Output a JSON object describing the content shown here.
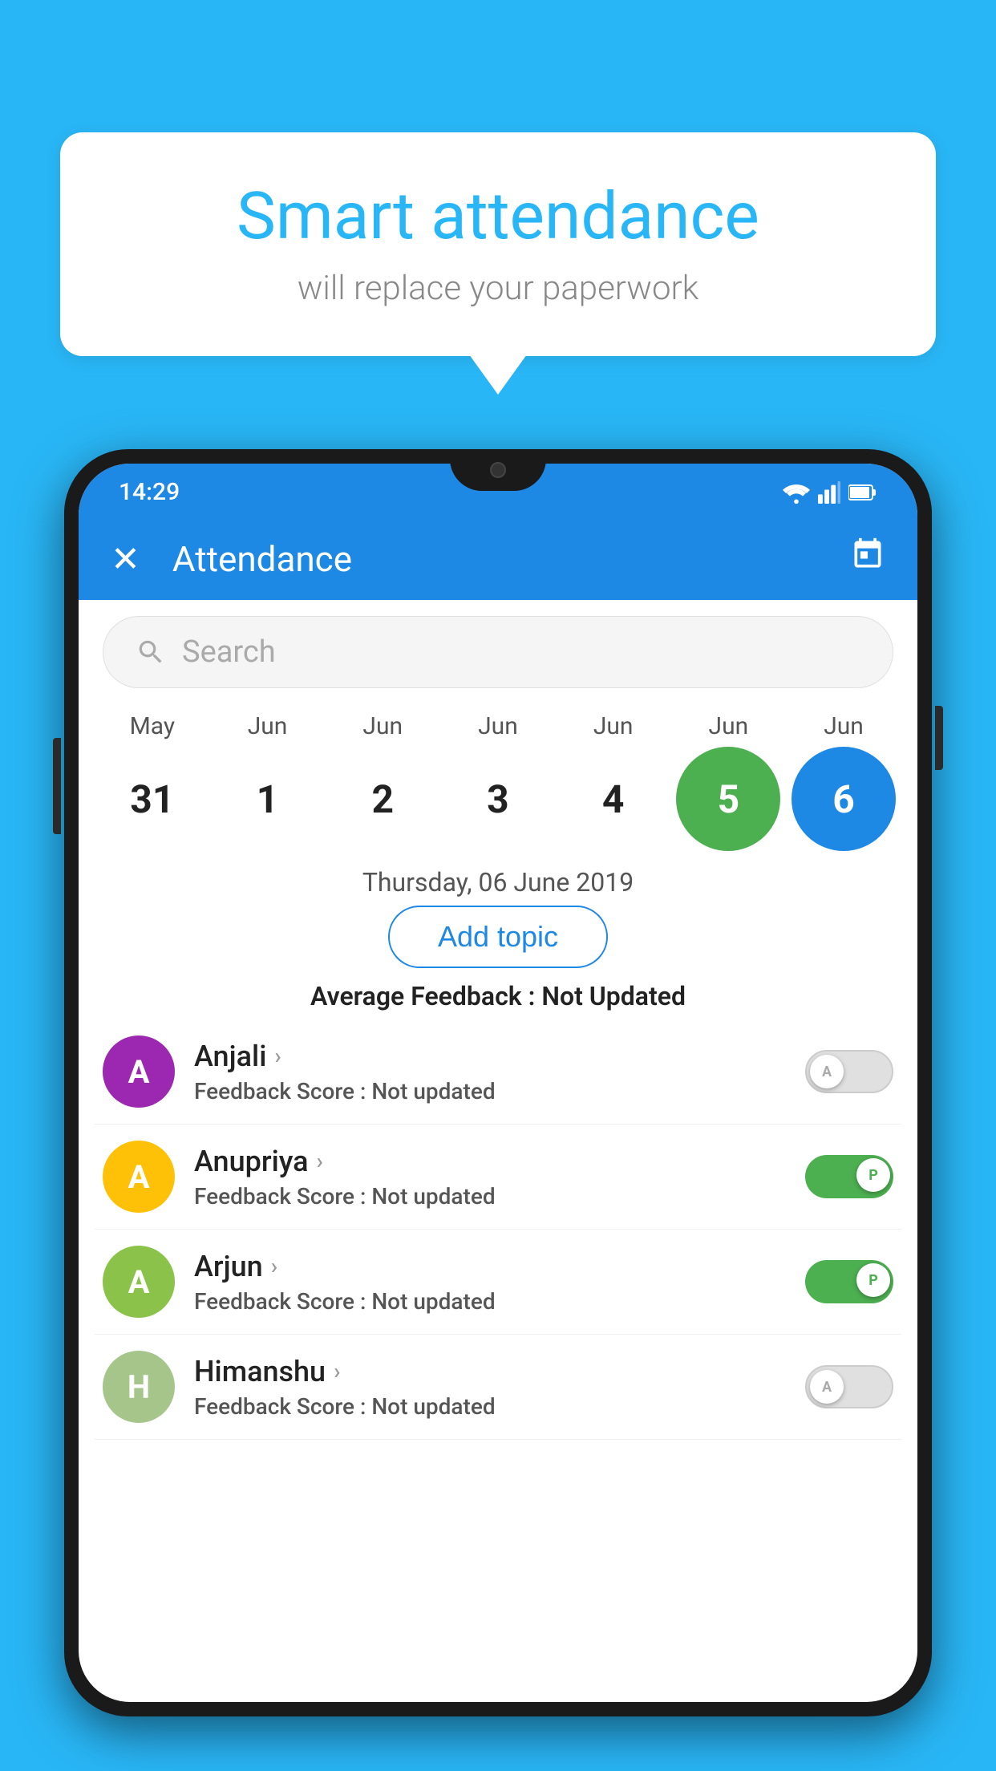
{
  "background_color": "#29B6F6",
  "speech_bubble": {
    "title": "Smart attendance",
    "subtitle": "will replace your paperwork"
  },
  "status_bar": {
    "time": "14:29",
    "wifi_icon": "wifi",
    "signal_icon": "signal",
    "battery_icon": "battery"
  },
  "app_bar": {
    "title": "Attendance",
    "close_icon": "×",
    "calendar_icon": "📅"
  },
  "search": {
    "placeholder": "Search"
  },
  "calendar": {
    "months": [
      "May",
      "Jun",
      "Jun",
      "Jun",
      "Jun",
      "Jun",
      "Jun"
    ],
    "dates": [
      "31",
      "1",
      "2",
      "3",
      "4",
      "5",
      "6"
    ],
    "today_index": 5,
    "selected_index": 6
  },
  "selected_date_label": "Thursday, 06 June 2019",
  "add_topic_label": "Add topic",
  "average_feedback": {
    "label": "Average Feedback : ",
    "value": "Not Updated"
  },
  "students": [
    {
      "name": "Anjali",
      "avatar_letter": "A",
      "avatar_color": "#9C27B0",
      "feedback_label": "Feedback Score : ",
      "feedback_value": "Not updated",
      "attendance": "absent",
      "toggle_label": "A"
    },
    {
      "name": "Anupriya",
      "avatar_letter": "A",
      "avatar_color": "#FFC107",
      "feedback_label": "Feedback Score : ",
      "feedback_value": "Not updated",
      "attendance": "present",
      "toggle_label": "P"
    },
    {
      "name": "Arjun",
      "avatar_letter": "A",
      "avatar_color": "#8BC34A",
      "feedback_label": "Feedback Score : ",
      "feedback_value": "Not updated",
      "attendance": "present",
      "toggle_label": "P"
    },
    {
      "name": "Himanshu",
      "avatar_letter": "H",
      "avatar_color": "#A5C58A",
      "feedback_label": "Feedback Score : ",
      "feedback_value": "Not updated",
      "attendance": "absent",
      "toggle_label": "A"
    }
  ]
}
